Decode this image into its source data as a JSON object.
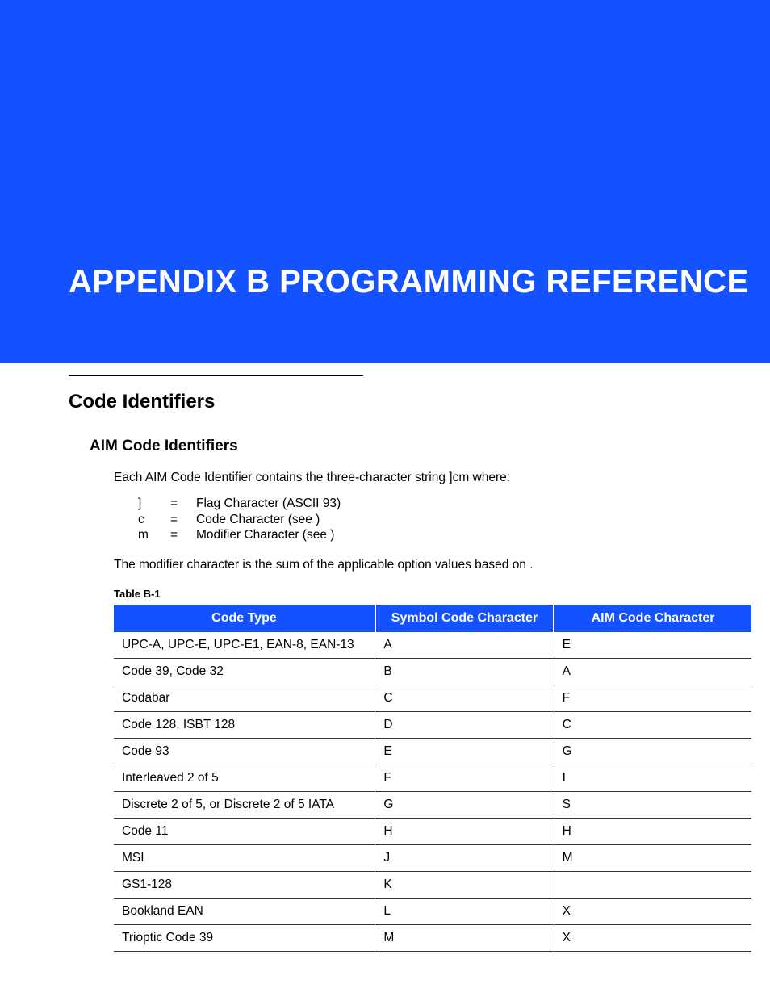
{
  "header": {
    "title": "APPENDIX B PROGRAMMING REFERENCE"
  },
  "section": {
    "h1": "Code Identifiers",
    "h2": "AIM Code Identifiers",
    "intro": "Each AIM Code Identifier contains the three-character string ]cm where:",
    "defs": [
      {
        "sym": "]",
        "eq": "=",
        "desc": "Flag Character (ASCII 93)"
      },
      {
        "sym": "c",
        "eq": "=",
        "desc": "Code Character (see                 )"
      },
      {
        "sym": "m",
        "eq": "=",
        "desc": "Modifier Character (see                       )"
      }
    ],
    "modifier_note": "The modifier character is the sum of the applicable option values based on                  ."
  },
  "table": {
    "caption": "Table B-1",
    "headers": [
      "Code Type",
      "Symbol Code Character",
      "AIM Code Character"
    ],
    "rows": [
      [
        "UPC-A, UPC-E, UPC-E1, EAN-8, EAN-13",
        "A",
        "E"
      ],
      [
        "Code 39, Code 32",
        "B",
        "A"
      ],
      [
        "Codabar",
        "C",
        "F"
      ],
      [
        "Code 128, ISBT 128",
        "D",
        "C"
      ],
      [
        "Code 93",
        "E",
        "G"
      ],
      [
        "Interleaved 2 of 5",
        "F",
        "I"
      ],
      [
        "Discrete 2 of 5, or Discrete 2 of 5 IATA",
        "G",
        "S"
      ],
      [
        "Code 11",
        "H",
        "H"
      ],
      [
        "MSI",
        "J",
        "M"
      ],
      [
        "GS1-128",
        "K",
        ""
      ],
      [
        "Bookland EAN",
        "L",
        "X"
      ],
      [
        "Trioptic Code 39",
        "M",
        "X"
      ]
    ]
  }
}
